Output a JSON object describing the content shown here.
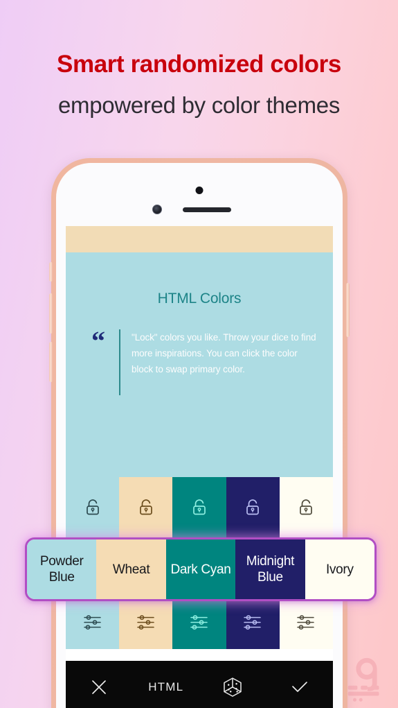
{
  "headline": {
    "line1": "Smart randomized colors",
    "line2": "empowered by color themes",
    "line1_color": "#c8000c",
    "line2_color": "#2e2c33"
  },
  "background": {
    "gradient_from": "#efcdf6",
    "gradient_to": "#fdc7c8"
  },
  "phone": {
    "bezel_color": "#efb5a0",
    "screen_color": "#fbfbfd"
  },
  "app": {
    "top_strip_color": "#f2dcb6",
    "card": {
      "background": "#addce3",
      "title": "HTML Colors",
      "title_color": "#1d8488",
      "quote_glyph": "“",
      "quote_glyph_color": "#1f2a78",
      "quote_rule_color": "#2d8a8c",
      "quote_text": "\"Lock\" colors you like. Throw your dice to find more inspirations. You can click the color block to swap primary color.",
      "quote_text_color": "#fdfdfd"
    },
    "palette": [
      {
        "name": "Powder Blue",
        "hex": "#addce3",
        "icon_color": "#2c4a50",
        "label_text_color": "#17181c"
      },
      {
        "name": "Wheat",
        "hex": "#f5dcb4",
        "icon_color": "#6b4c1c",
        "label_text_color": "#17181c"
      },
      {
        "name": "Dark Cyan",
        "hex": "#00857f",
        "icon_color": "#8ff0e2",
        "label_text_color": "#ffffff"
      },
      {
        "name": "Midnight Blue",
        "hex": "#211f68",
        "icon_color": "#b9bdf2",
        "label_text_color": "#ffffff"
      },
      {
        "name": "Ivory",
        "hex": "#fffdf2",
        "icon_color": "#4e4a3b",
        "label_text_color": "#17181c"
      }
    ],
    "lock_icon_name": "unlocked-padlock-icon",
    "tune_icon_name": "sliders-icon",
    "overlay_border_color": "#b14ec4",
    "toolbar": {
      "background": "#090909",
      "close_label": "close-icon",
      "title": "HTML",
      "dice_label": "dice-icon",
      "confirm_label": "check-icon",
      "icon_color": "#e9e9e9"
    }
  }
}
